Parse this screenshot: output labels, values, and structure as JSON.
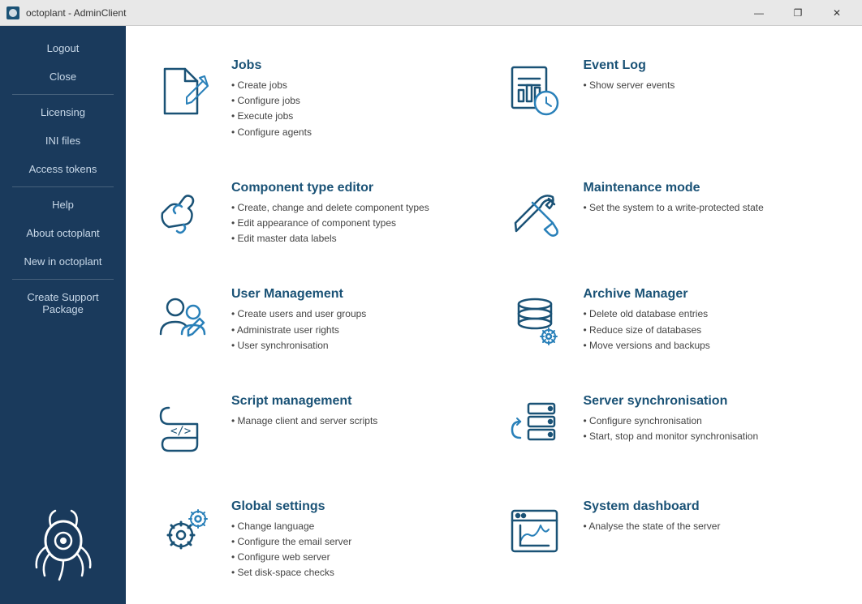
{
  "titlebar": {
    "title": "octoplant - AdminClient",
    "minimize": "—",
    "maximize": "❐",
    "close": "✕"
  },
  "sidebar": {
    "items": [
      {
        "id": "logout",
        "label": "Logout"
      },
      {
        "id": "close",
        "label": "Close"
      },
      {
        "id": "licensing",
        "label": "Licensing"
      },
      {
        "id": "ini-files",
        "label": "INI files"
      },
      {
        "id": "access-tokens",
        "label": "Access tokens"
      },
      {
        "id": "help",
        "label": "Help"
      },
      {
        "id": "about",
        "label": "About octoplant"
      },
      {
        "id": "new-in",
        "label": "New in octoplant"
      },
      {
        "id": "support",
        "label": "Create Support Package"
      }
    ]
  },
  "cards": [
    {
      "id": "jobs",
      "title": "Jobs",
      "bullets": [
        "Create jobs",
        "Configure jobs",
        "Execute jobs",
        "Configure agents"
      ],
      "icon": "jobs"
    },
    {
      "id": "event-log",
      "title": "Event Log",
      "bullets": [
        "Show server events"
      ],
      "icon": "event-log"
    },
    {
      "id": "component-type-editor",
      "title": "Component type editor",
      "bullets": [
        "Create, change and delete component types",
        "Edit appearance of component types",
        "Edit master data labels"
      ],
      "icon": "component-type-editor"
    },
    {
      "id": "maintenance-mode",
      "title": "Maintenance mode",
      "bullets": [
        "Set the system to a write-protected state"
      ],
      "icon": "maintenance-mode"
    },
    {
      "id": "user-management",
      "title": "User Management",
      "bullets": [
        "Create users and user groups",
        "Administrate user rights",
        "User synchronisation"
      ],
      "icon": "user-management"
    },
    {
      "id": "archive-manager",
      "title": "Archive Manager",
      "bullets": [
        "Delete old database entries",
        "Reduce size of databases",
        "Move versions and backups"
      ],
      "icon": "archive-manager"
    },
    {
      "id": "script-management",
      "title": "Script management",
      "bullets": [
        "Manage client and server scripts"
      ],
      "icon": "script-management"
    },
    {
      "id": "server-synchronisation",
      "title": "Server synchronisation",
      "bullets": [
        "Configure synchronisation",
        "Start, stop and monitor synchronisation"
      ],
      "icon": "server-synchronisation"
    },
    {
      "id": "global-settings",
      "title": "Global settings",
      "bullets": [
        "Change language",
        "Configure the email server",
        "Configure web server",
        "Set disk-space checks"
      ],
      "icon": "global-settings"
    },
    {
      "id": "system-dashboard",
      "title": "System dashboard",
      "bullets": [
        "Analyse the state of the server"
      ],
      "icon": "system-dashboard"
    }
  ]
}
